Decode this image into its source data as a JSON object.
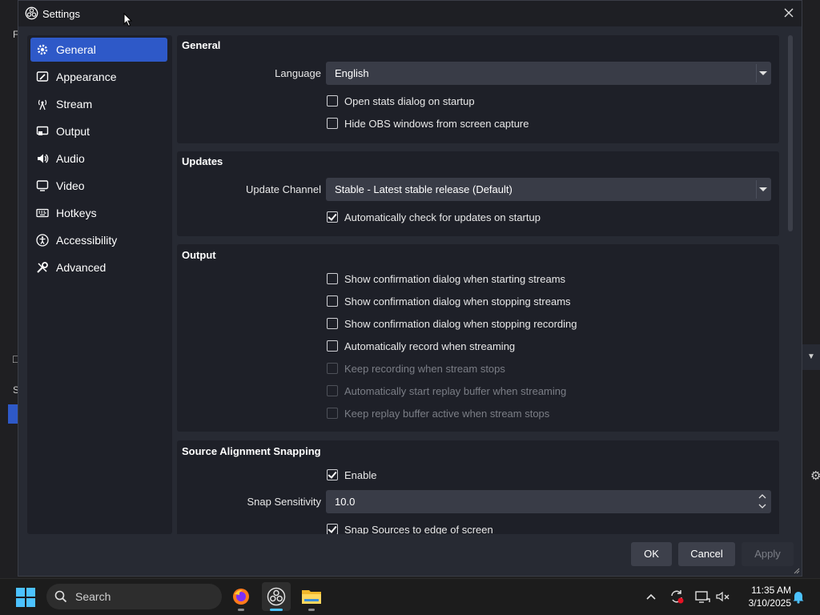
{
  "window": {
    "title": "Settings"
  },
  "sidebar": {
    "items": [
      {
        "label": "General",
        "icon": "gear-icon",
        "active": true
      },
      {
        "label": "Appearance",
        "icon": "appearance-icon"
      },
      {
        "label": "Stream",
        "icon": "antenna-icon"
      },
      {
        "label": "Output",
        "icon": "output-icon"
      },
      {
        "label": "Audio",
        "icon": "speaker-icon"
      },
      {
        "label": "Video",
        "icon": "monitor-icon"
      },
      {
        "label": "Hotkeys",
        "icon": "keyboard-icon"
      },
      {
        "label": "Accessibility",
        "icon": "accessibility-icon"
      },
      {
        "label": "Advanced",
        "icon": "wrench-icon"
      }
    ]
  },
  "general": {
    "title": "General",
    "language_label": "Language",
    "language_value": "English",
    "open_stats_label": "Open stats dialog on startup",
    "open_stats_checked": false,
    "hide_obs_label": "Hide OBS windows from screen capture",
    "hide_obs_checked": false
  },
  "updates": {
    "title": "Updates",
    "channel_label": "Update Channel",
    "channel_value": "Stable - Latest stable release (Default)",
    "auto_check_label": "Automatically check for updates on startup",
    "auto_check_checked": true
  },
  "output": {
    "title": "Output",
    "options": [
      {
        "label": "Show confirmation dialog when starting streams",
        "checked": false,
        "disabled": false
      },
      {
        "label": "Show confirmation dialog when stopping streams",
        "checked": false,
        "disabled": false
      },
      {
        "label": "Show confirmation dialog when stopping recording",
        "checked": false,
        "disabled": false
      },
      {
        "label": "Automatically record when streaming",
        "checked": false,
        "disabled": false
      },
      {
        "label": "Keep recording when stream stops",
        "checked": false,
        "disabled": true
      },
      {
        "label": "Automatically start replay buffer when streaming",
        "checked": false,
        "disabled": true
      },
      {
        "label": "Keep replay buffer active when stream stops",
        "checked": false,
        "disabled": true
      }
    ]
  },
  "snapping": {
    "title": "Source Alignment Snapping",
    "enable_label": "Enable",
    "enable_checked": true,
    "sensitivity_label": "Snap Sensitivity",
    "sensitivity_value": "10.0",
    "snap_edge_label": "Snap Sources to edge of screen",
    "snap_edge_checked": true
  },
  "buttons": {
    "ok": "OK",
    "cancel": "Cancel",
    "apply": "Apply"
  },
  "taskbar": {
    "search_placeholder": "Search",
    "apps": [
      "firefox-icon",
      "obs-icon",
      "file-explorer-icon"
    ],
    "time": "11:35 AM",
    "date": "3/10/2025"
  },
  "colors": {
    "accent": "#2e59c8",
    "panel": "#1e2028",
    "window": "#272a33"
  }
}
